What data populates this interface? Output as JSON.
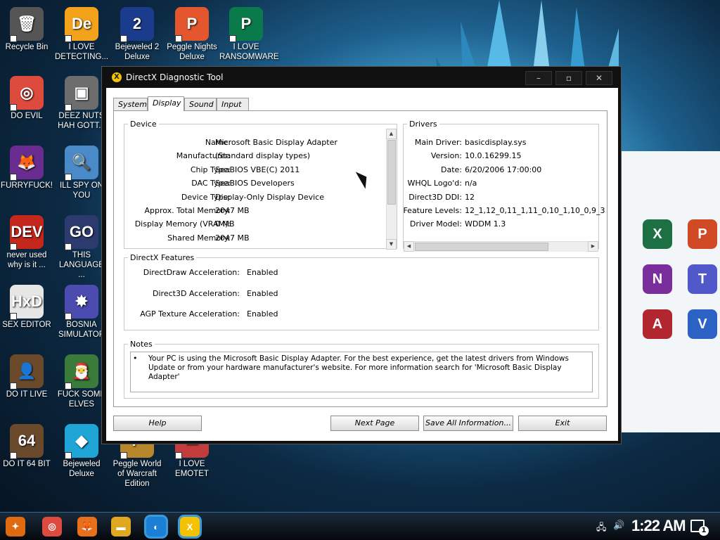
{
  "desktop": {
    "icons": [
      {
        "label": "Recycle Bin",
        "glyph": "🗑",
        "color": "#555555"
      },
      {
        "label": "I LOVE DETECTING...",
        "glyph": "De",
        "color": "#f2a21b"
      },
      {
        "label": "Bejeweled 2 Deluxe",
        "glyph": "2",
        "color": "#1b3c8c"
      },
      {
        "label": "Peggle Nights Deluxe",
        "glyph": "P",
        "color": "#e4572e"
      },
      {
        "label": "I LOVE RANSOMWARE",
        "glyph": "P",
        "color": "#0b7a4b"
      },
      {
        "label": "DO EVIL",
        "glyph": "◎",
        "color": "#dd4b3e"
      },
      {
        "label": "DEEZ NUTS HAH GOTT...",
        "glyph": "▣",
        "color": "#6d6d6d"
      },
      {
        "label": "FURRYFUCK!",
        "glyph": "🦊",
        "color": "#6b2c91"
      },
      {
        "label": "ILL SPY ON YOU",
        "glyph": "🔍",
        "color": "#4a8ac8"
      },
      {
        "label": "never used why is it ...",
        "glyph": "DEV",
        "color": "#c4271c"
      },
      {
        "label": "THIS LANGUAGE ...",
        "glyph": "GO",
        "color": "#2c3a6e"
      },
      {
        "label": "SEX EDITOR",
        "glyph": "HxD",
        "color": "#e6e6e6"
      },
      {
        "label": "BOSNIA SIMULATOR",
        "glyph": "✸",
        "color": "#4b4bb0"
      },
      {
        "label": "DO IT LIVE",
        "glyph": "👤",
        "color": "#6b4a2c"
      },
      {
        "label": "FUCK SOME ELVES",
        "glyph": "🎅",
        "color": "#3a7a3a"
      },
      {
        "label": "DO IT 64 BIT",
        "glyph": "64",
        "color": "#6b4a2c"
      },
      {
        "label": "Bejeweled Deluxe",
        "glyph": "◆",
        "color": "#1fa5d6"
      },
      {
        "label": "Peggle World of Warcraft Edition",
        "glyph": "P",
        "color": "#b8862b"
      },
      {
        "label": "I LOVE EMOTET",
        "glyph": "✉",
        "color": "#c43b3b"
      }
    ],
    "office_icons": [
      {
        "letter": "X",
        "color": "#1d7044"
      },
      {
        "letter": "P",
        "color": "#d04b25"
      },
      {
        "letter": "N",
        "color": "#7a2e9c"
      },
      {
        "letter": "T",
        "color": "#5059c9"
      },
      {
        "letter": "A",
        "color": "#b2262f"
      },
      {
        "letter": "V",
        "color": "#2b62c4"
      }
    ]
  },
  "window": {
    "title": "DirectX Diagnostic Tool",
    "minimize": "–",
    "maximize": "▫",
    "close": "✕",
    "tabs": [
      "System",
      "Display",
      "Sound",
      "Input"
    ],
    "active_tab": "Display"
  },
  "device": {
    "legend": "Device",
    "rows": [
      {
        "label": "Name:",
        "value": "Microsoft Basic Display Adapter"
      },
      {
        "label": "Manufacturer:",
        "value": "(Standard display types)"
      },
      {
        "label": "Chip Type:",
        "value": "SeaBIOS VBE(C) 2011"
      },
      {
        "label": "DAC Type:",
        "value": "SeaBIOS Developers"
      },
      {
        "label": "Device Type:",
        "value": "Display-Only Display Device"
      },
      {
        "label": "Approx. Total Memory:",
        "value": "2047 MB"
      },
      {
        "label": "Display Memory (VRAM):",
        "value": "0 MB"
      },
      {
        "label": "Shared Memory:",
        "value": "2047 MB"
      }
    ]
  },
  "drivers": {
    "legend": "Drivers",
    "rows": [
      {
        "label": "Main Driver:",
        "value": "basicdisplay.sys"
      },
      {
        "label": "Version:",
        "value": "10.0.16299.15"
      },
      {
        "label": "Date:",
        "value": "6/20/2006 17:00:00"
      },
      {
        "label": "WHQL Logo'd:",
        "value": "n/a"
      },
      {
        "label": "Direct3D DDI:",
        "value": "12"
      },
      {
        "label": "Feature Levels:",
        "value": "12_1,12_0,11_1,11_0,10_1,10_0,9_3"
      },
      {
        "label": "Driver Model:",
        "value": "WDDM 1.3"
      }
    ]
  },
  "features": {
    "legend": "DirectX Features",
    "rows": [
      {
        "label": "DirectDraw Acceleration:",
        "value": "Enabled"
      },
      {
        "label": "Direct3D Acceleration:",
        "value": "Enabled"
      },
      {
        "label": "AGP Texture Acceleration:",
        "value": "Enabled"
      }
    ]
  },
  "notes": {
    "legend": "Notes",
    "bullet": "•",
    "text": "Your PC is using the Microsoft Basic Display Adapter. For the best experience, get the latest drivers from Windows Update or from your hardware manufacturer's website. For more information search for 'Microsoft Basic Display Adapter'"
  },
  "buttons": {
    "help": "Help",
    "next_page": "Next Page",
    "save_all": "Save All Information...",
    "exit": "Exit"
  },
  "taskbar": {
    "time": "1:22 AM",
    "notification_count": "1",
    "items": [
      {
        "name": "start",
        "glyph": "✦",
        "color": "#e06a10"
      },
      {
        "name": "chrome",
        "glyph": "◎",
        "color": "#dd4b3e"
      },
      {
        "name": "firefox",
        "glyph": "🦊",
        "color": "#e8701a"
      },
      {
        "name": "file-explorer",
        "glyph": "▬",
        "color": "#e0a820"
      },
      {
        "name": "cortana",
        "glyph": "◐",
        "color": "#1b7fd6"
      },
      {
        "name": "dxdiag",
        "glyph": "X",
        "color": "#f4c200"
      }
    ]
  }
}
